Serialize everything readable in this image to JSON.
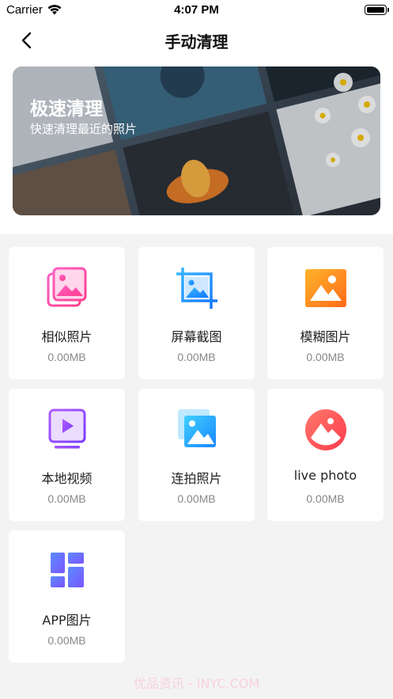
{
  "status_bar": {
    "carrier": "Carrier",
    "time": "4:07 PM"
  },
  "nav": {
    "title": "手动清理",
    "back_icon": "chevron-left-icon"
  },
  "banner": {
    "title": "极速清理",
    "subtitle": "快速清理最近的照片"
  },
  "categories": [
    {
      "label": "相似照片",
      "size": "0.00MB",
      "icon": "similar-photos-icon"
    },
    {
      "label": "屏幕截图",
      "size": "0.00MB",
      "icon": "screenshot-icon"
    },
    {
      "label": "模糊图片",
      "size": "0.00MB",
      "icon": "blurry-image-icon"
    },
    {
      "label": "本地视频",
      "size": "0.00MB",
      "icon": "video-icon"
    },
    {
      "label": "连拍照片",
      "size": "0.00MB",
      "icon": "burst-photos-icon"
    },
    {
      "label": "live photo",
      "size": "0.00MB",
      "icon": "live-photo-icon"
    },
    {
      "label": "APP图片",
      "size": "0.00MB",
      "icon": "app-images-icon"
    }
  ],
  "colors": {
    "pink": "#ff4fa8",
    "blue": "#1f8fff",
    "orange": "#ff8a1f",
    "purple": "#8a4dff",
    "red": "#ff4a5a",
    "indigo": "#6a6cf6"
  },
  "watermark": "优品资讯 - INYC.COM"
}
